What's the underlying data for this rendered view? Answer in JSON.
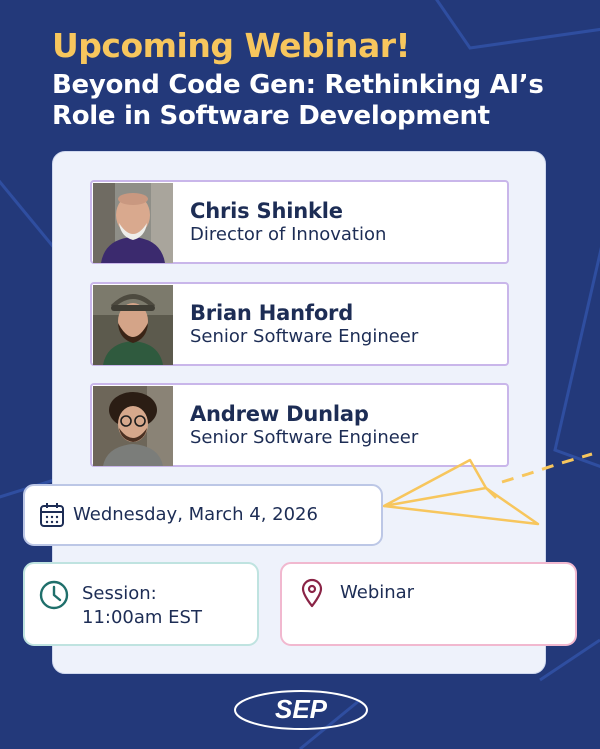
{
  "header": {
    "eyebrow": "Upcoming Webinar!",
    "title": "Beyond Code Gen: Rethinking AI’s Role in Software Development"
  },
  "speakers": [
    {
      "name": "Chris Shinkle",
      "role": "Director of Innovation"
    },
    {
      "name": "Brian Hanford",
      "role": "Senior Software Engineer"
    },
    {
      "name": "Andrew Dunlap",
      "role": "Senior Software Engineer"
    }
  ],
  "event": {
    "date": "Wednesday, March 4, 2026",
    "session_label": "Session:",
    "session_time": "11:00am EST",
    "location": "Webinar"
  },
  "brand": {
    "logo_text": "SEP"
  },
  "colors": {
    "background": "#23397a",
    "accent_yellow": "#f7c65d",
    "panel": "#eef2fb",
    "text_dark": "#1d2d55",
    "speaker_border": "#c9b6ea",
    "date_border": "#bcc7e6",
    "session_border": "#bfe3e0",
    "location_border": "#f1b8cf"
  },
  "icons": [
    "calendar-icon",
    "clock-icon",
    "location-pin-icon",
    "paper-plane-icon"
  ]
}
